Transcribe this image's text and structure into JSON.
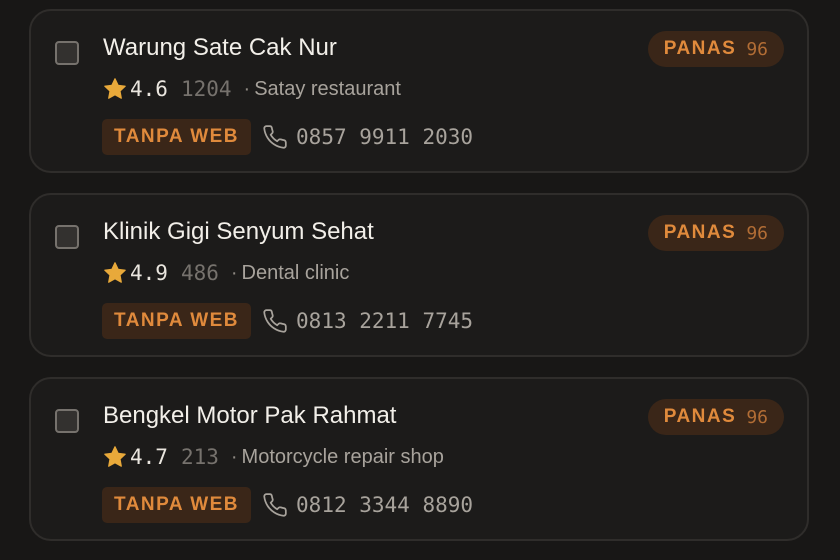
{
  "colors": {
    "background": "#181716",
    "card": "#1c1b1a",
    "accent": "#e08a3c",
    "badge_bg": "#3a2618",
    "star": "#e8a93a"
  },
  "icons": {
    "checkbox": "checkbox-empty",
    "rating": "star-icon",
    "phone": "phone-icon"
  },
  "leads": [
    {
      "name": "Warung Sate Cak Nur",
      "heat_label": "PANAS",
      "heat_score": "96",
      "rating": "4.6",
      "reviews": "1204",
      "separator": "·",
      "category": "Satay restaurant",
      "web_status": "TANPA WEB",
      "phone": "0857 9911 2030"
    },
    {
      "name": "Klinik Gigi Senyum Sehat",
      "heat_label": "PANAS",
      "heat_score": "96",
      "rating": "4.9",
      "reviews": "486",
      "separator": "·",
      "category": "Dental clinic",
      "web_status": "TANPA WEB",
      "phone": "0813 2211 7745"
    },
    {
      "name": "Bengkel Motor Pak Rahmat",
      "heat_label": "PANAS",
      "heat_score": "96",
      "rating": "4.7",
      "reviews": "213",
      "separator": "·",
      "category": "Motorcycle repair shop",
      "web_status": "TANPA WEB",
      "phone": "0812 3344 8890"
    }
  ]
}
